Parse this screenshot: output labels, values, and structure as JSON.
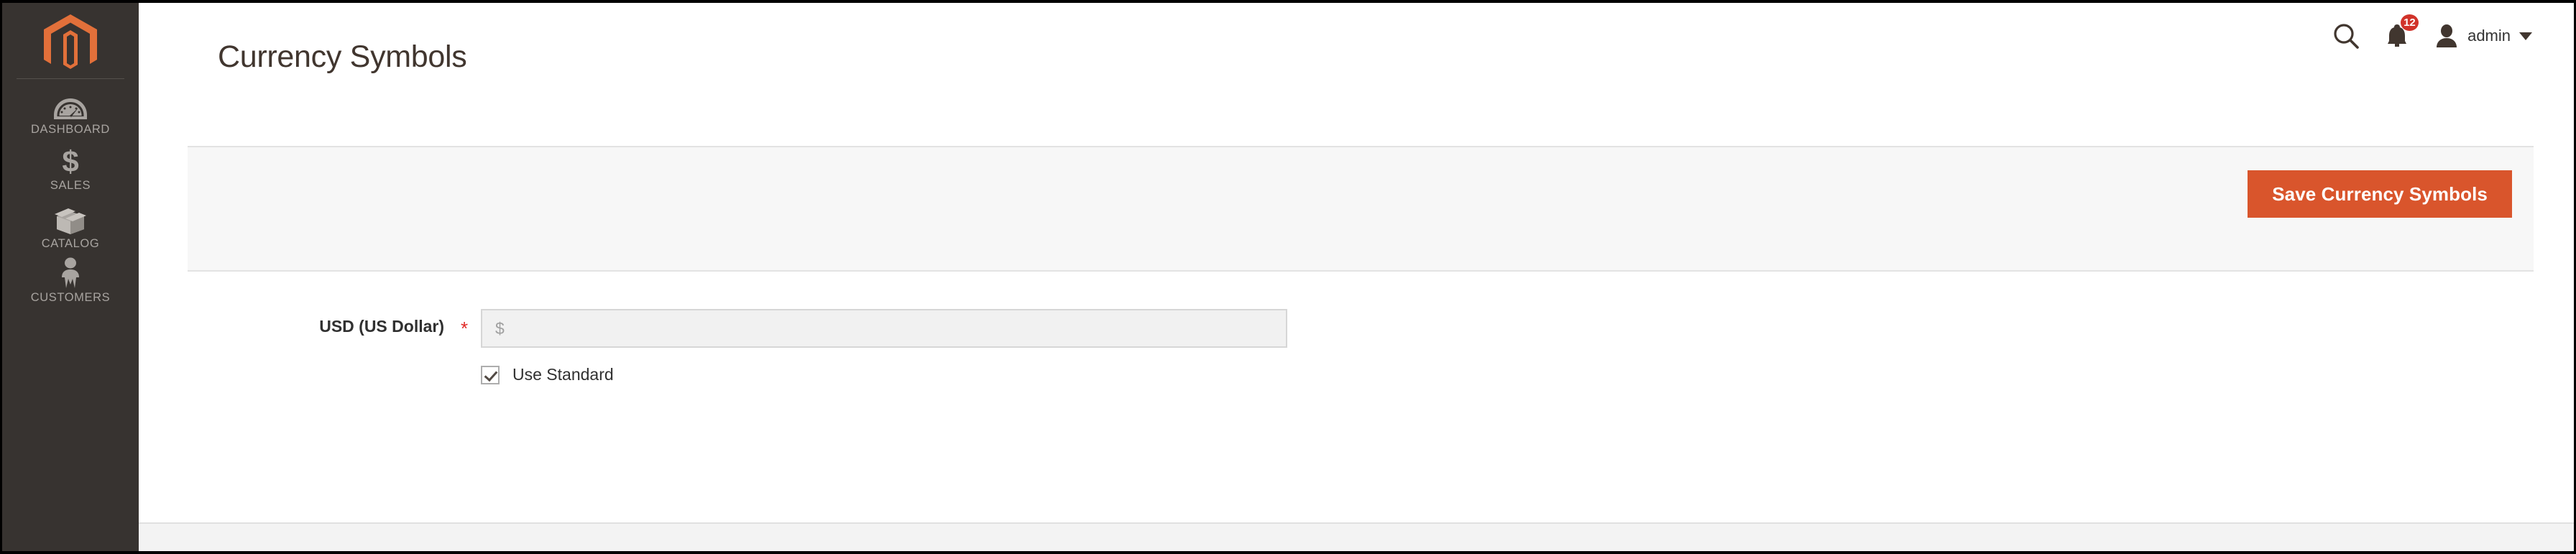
{
  "sidebar": {
    "logo": {
      "icon": "magento-logo-icon",
      "color": "#e2703a"
    },
    "items": [
      {
        "icon": "dashboard-gauge-icon",
        "label": "DASHBOARD"
      },
      {
        "icon": "sales-dollar-icon",
        "label": "SALES"
      },
      {
        "icon": "catalog-box-icon",
        "label": "CATALOG"
      },
      {
        "icon": "customers-person-icon",
        "label": "CUSTOMERS"
      }
    ]
  },
  "header": {
    "title": "Currency Symbols",
    "search_icon": "search-icon",
    "notifications_icon": "bell-icon",
    "notifications_count": "12",
    "user_icon": "user-avatar-icon",
    "user_name": "admin",
    "user_caret": "chevron-down-icon"
  },
  "toolbar": {
    "save_label": "Save Currency Symbols",
    "accent_color": "#d9552c"
  },
  "form": {
    "field_label": "USD (US Dollar)",
    "required_mark": "*",
    "input_value": "",
    "input_placeholder": "$",
    "checkbox_label": "Use Standard",
    "checkbox_checked": true
  }
}
